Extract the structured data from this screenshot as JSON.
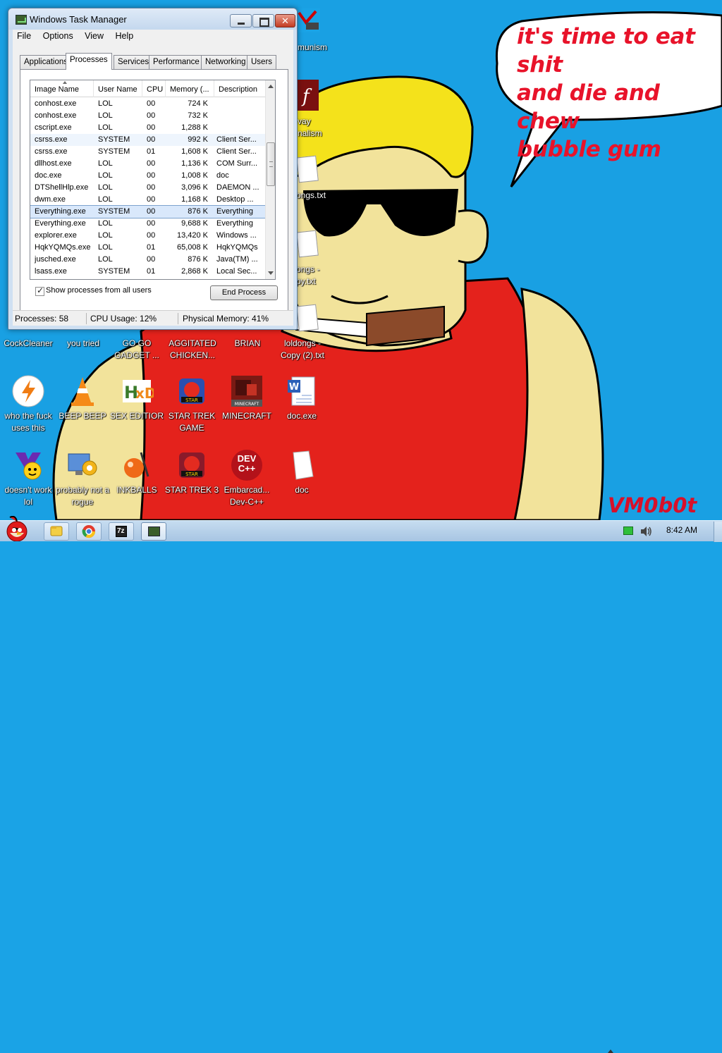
{
  "wallpaper": {
    "speech_text": "it's time to eat shit\nand die and chew\nbubble gum",
    "signature": "VM0b0t"
  },
  "task_manager": {
    "title": "Windows Task Manager",
    "menu": [
      "File",
      "Options",
      "View",
      "Help"
    ],
    "tabs": [
      "Applications",
      "Processes",
      "Services",
      "Performance",
      "Networking",
      "Users"
    ],
    "active_tab": "Processes",
    "columns": [
      "Image Name",
      "User Name",
      "CPU",
      "Memory (...",
      "Description"
    ],
    "rows": [
      {
        "name": "conhost.exe",
        "user": "LOL",
        "cpu": "00",
        "mem": "724 K",
        "desc": ""
      },
      {
        "name": "conhost.exe",
        "user": "LOL",
        "cpu": "00",
        "mem": "732 K",
        "desc": ""
      },
      {
        "name": "cscript.exe",
        "user": "LOL",
        "cpu": "00",
        "mem": "1,288 K",
        "desc": ""
      },
      {
        "name": "csrss.exe",
        "user": "SYSTEM",
        "cpu": "00",
        "mem": "992 K",
        "desc": "Client Ser..."
      },
      {
        "name": "csrss.exe",
        "user": "SYSTEM",
        "cpu": "01",
        "mem": "1,608 K",
        "desc": "Client Ser..."
      },
      {
        "name": "dllhost.exe",
        "user": "LOL",
        "cpu": "00",
        "mem": "1,136 K",
        "desc": "COM Surr..."
      },
      {
        "name": "doc.exe",
        "user": "LOL",
        "cpu": "00",
        "mem": "1,008 K",
        "desc": "doc"
      },
      {
        "name": "DTShellHlp.exe",
        "user": "LOL",
        "cpu": "00",
        "mem": "3,096 K",
        "desc": "DAEMON ..."
      },
      {
        "name": "dwm.exe",
        "user": "LOL",
        "cpu": "00",
        "mem": "1,168 K",
        "desc": "Desktop ..."
      },
      {
        "name": "Everything.exe",
        "user": "SYSTEM",
        "cpu": "00",
        "mem": "876 K",
        "desc": "Everything"
      },
      {
        "name": "Everything.exe",
        "user": "LOL",
        "cpu": "00",
        "mem": "9,688 K",
        "desc": "Everything"
      },
      {
        "name": "explorer.exe",
        "user": "LOL",
        "cpu": "00",
        "mem": "13,420 K",
        "desc": "Windows ..."
      },
      {
        "name": "HqkYQMQs.exe",
        "user": "LOL",
        "cpu": "01",
        "mem": "65,008 K",
        "desc": "HqkYQMQs"
      },
      {
        "name": "jusched.exe",
        "user": "LOL",
        "cpu": "00",
        "mem": "876 K",
        "desc": "Java(TM) ..."
      },
      {
        "name": "lsass.exe",
        "user": "SYSTEM",
        "cpu": "01",
        "mem": "2,868 K",
        "desc": "Local Sec..."
      }
    ],
    "show_all_label": "Show processes from all users",
    "show_all_checked": true,
    "end_process_label": "End Process",
    "status": {
      "processes": "Processes: 58",
      "cpu": "CPU Usage: 12%",
      "memory": "Physical Memory: 41%"
    }
  },
  "desktop": {
    "partial_labels": {
      "communism": "munism",
      "flash_top": "vay",
      "flash_bottom": "nalism",
      "loldongs1": "ongs.txt",
      "loldongs2_top": "ongs -",
      "loldongs2_bottom": "py.txt"
    },
    "row1": [
      {
        "label": "CockCleaner"
      },
      {
        "label": "you tried"
      },
      {
        "label": "GO GO GADGET ..."
      },
      {
        "label": "AGGITATED CHICKEN..."
      },
      {
        "label": "BRIAN"
      },
      {
        "label": "loldongs - Copy (2).txt"
      }
    ],
    "row2": [
      {
        "label": "who the fuck uses this",
        "icon": "avast-icon"
      },
      {
        "label": "BEEP BEEP",
        "icon": "vlc-cone-icon"
      },
      {
        "label": "SEX EDITIOR",
        "icon": "hxd-icon"
      },
      {
        "label": "STAR TREK GAME",
        "icon": "star-wars-game-icon"
      },
      {
        "label": "MINECRAFT",
        "icon": "minecraft-icon"
      },
      {
        "label": "doc.exe",
        "icon": "word-document-icon"
      }
    ],
    "row3": [
      {
        "label": "doesn't work lol",
        "icon": "yahoo-messenger-icon"
      },
      {
        "label": "probably not a rogue",
        "icon": "gear-monitor-icon"
      },
      {
        "label": "INKBALLS",
        "icon": "inkball-icon"
      },
      {
        "label": "STAR TREK 3",
        "icon": "star-wars-game-icon"
      },
      {
        "label": "Embarcad... Dev-C++",
        "icon": "dev-cpp-icon"
      },
      {
        "label": "doc",
        "icon": "blank-document-icon"
      }
    ],
    "dev_icon_text": "DEV\nC++"
  },
  "taskbar": {
    "time": "8:42 AM",
    "pinned": [
      "explorer-folder-icon",
      "chrome-icon",
      "7zip-icon",
      "task-manager-icon"
    ],
    "sevenzip_text": "7z"
  }
}
